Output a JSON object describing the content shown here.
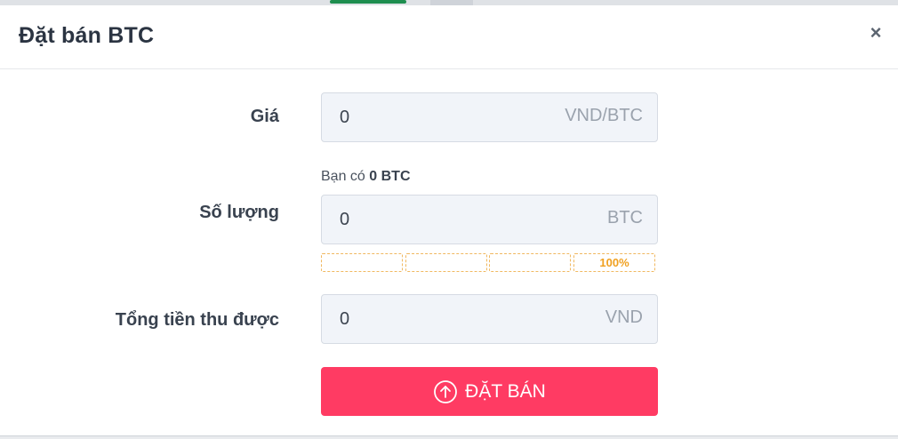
{
  "dialog": {
    "title": "Đặt bán BTC",
    "close_symbol": "×"
  },
  "form": {
    "price": {
      "label": "Giá",
      "value": "0",
      "unit": "VND/BTC"
    },
    "balance": {
      "prefix": "Bạn có",
      "amount": "0 BTC"
    },
    "quantity": {
      "label": "Số lượng",
      "value": "0",
      "unit": "BTC"
    },
    "percent_buttons": [
      "",
      "",
      "",
      "100%"
    ],
    "total": {
      "label": "Tổng tiền thu được",
      "value": "0",
      "unit": "VND"
    },
    "submit_label": "ĐẶT BÁN"
  },
  "colors": {
    "submit": "#ff3b63",
    "percent_accent": "#f0a020",
    "tab_accent": "#1e8e4f"
  },
  "icons": {
    "close": "close-icon",
    "submit": "arrow-up-circle-icon"
  }
}
